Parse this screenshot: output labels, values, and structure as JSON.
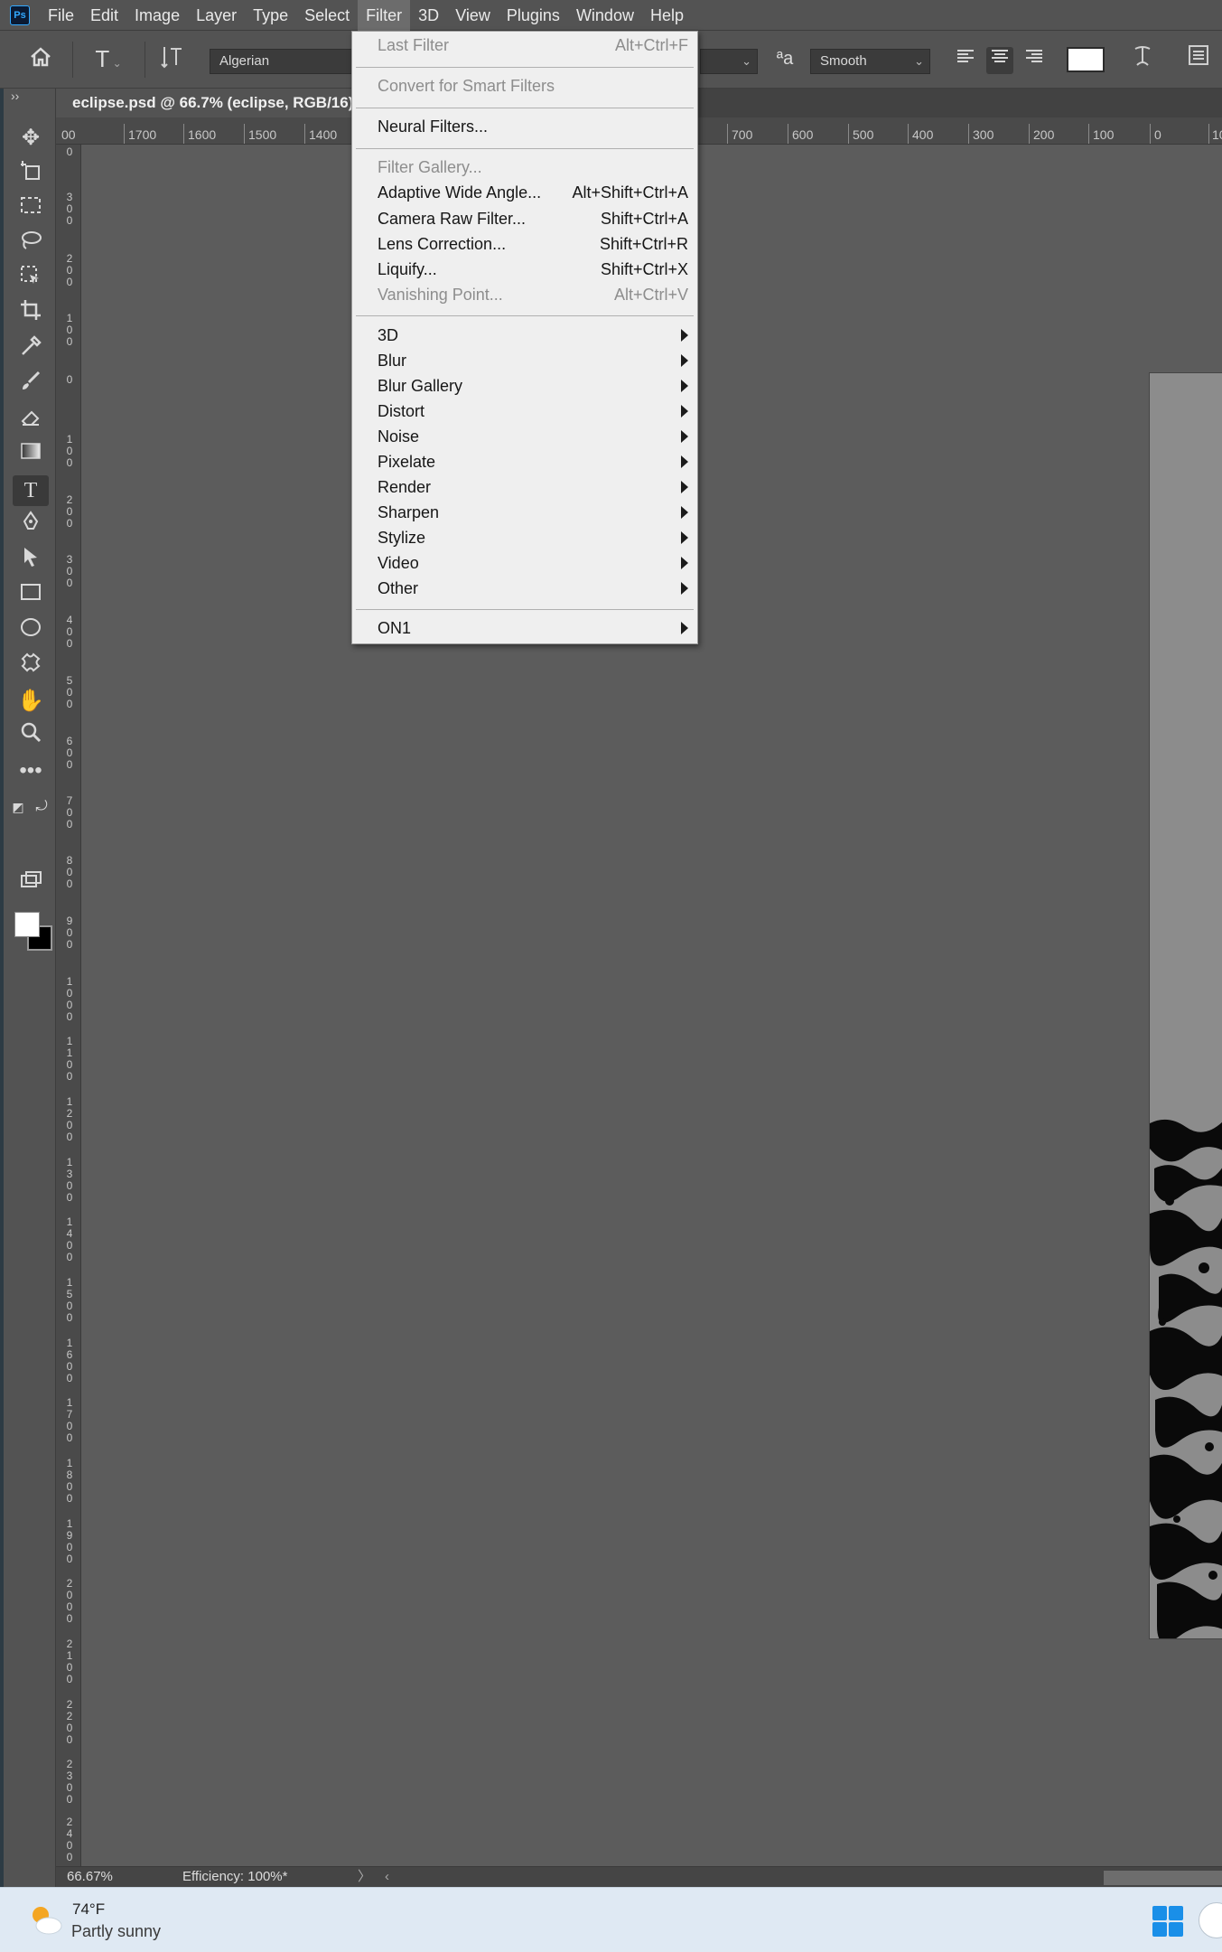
{
  "app": {
    "logo_text": "Ps",
    "menus": [
      "File",
      "Edit",
      "Image",
      "Layer",
      "Type",
      "Select",
      "Filter",
      "3D",
      "View",
      "Plugins",
      "Window",
      "Help"
    ],
    "active_menu": "Filter"
  },
  "options": {
    "font_family": "Algerian",
    "font_style_placeholder": "",
    "anti_alias_glyph": "aa",
    "anti_alias": "Smooth",
    "color": "#ffffff"
  },
  "document": {
    "tab_title": "eclipse.psd @ 66.7% (eclipse, RGB/16) *"
  },
  "ruler": {
    "h_labels": [
      "00",
      "1700",
      "1600",
      "1500",
      "1400",
      "700",
      "600",
      "500",
      "400",
      "300",
      "200",
      "100",
      "0",
      "10"
    ],
    "v_labels": [
      "0",
      "300",
      "200",
      "100",
      "0",
      "100",
      "200",
      "300",
      "400",
      "500",
      "600",
      "700",
      "800",
      "900",
      "1000",
      "1100",
      "1200",
      "1300",
      "1400",
      "1500",
      "1600",
      "1700",
      "1800",
      "1900",
      "2000",
      "2100",
      "2200",
      "2300",
      "2400"
    ]
  },
  "filter_menu": {
    "items": [
      {
        "label": "Last Filter",
        "shortcut": "Alt+Ctrl+F",
        "disabled": true
      },
      {
        "label": "Convert for Smart Filters",
        "shortcut": "",
        "disabled": true
      },
      {
        "label": "Neural Filters...",
        "shortcut": "",
        "disabled": false
      },
      {
        "label": "Filter Gallery...",
        "shortcut": "",
        "disabled": true
      },
      {
        "label": "Adaptive Wide Angle...",
        "shortcut": "Alt+Shift+Ctrl+A",
        "disabled": false
      },
      {
        "label": "Camera Raw Filter...",
        "shortcut": "Shift+Ctrl+A",
        "disabled": false
      },
      {
        "label": "Lens Correction...",
        "shortcut": "Shift+Ctrl+R",
        "disabled": false
      },
      {
        "label": "Liquify...",
        "shortcut": "Shift+Ctrl+X",
        "disabled": false
      },
      {
        "label": "Vanishing Point...",
        "shortcut": "Alt+Ctrl+V",
        "disabled": true
      },
      {
        "label": "3D",
        "submenu": true
      },
      {
        "label": "Blur",
        "submenu": true
      },
      {
        "label": "Blur Gallery",
        "submenu": true
      },
      {
        "label": "Distort",
        "submenu": true
      },
      {
        "label": "Noise",
        "submenu": true
      },
      {
        "label": "Pixelate",
        "submenu": true
      },
      {
        "label": "Render",
        "submenu": true
      },
      {
        "label": "Sharpen",
        "submenu": true
      },
      {
        "label": "Stylize",
        "submenu": true
      },
      {
        "label": "Video",
        "submenu": true
      },
      {
        "label": "Other",
        "submenu": true
      },
      {
        "label": "ON1",
        "submenu": true
      }
    ]
  },
  "status": {
    "zoom": "66.67%",
    "efficiency": "Efficiency: 100%*"
  },
  "taskbar": {
    "temperature": "74°F",
    "condition": "Partly sunny"
  },
  "colors": {
    "foreground": "#ffffff",
    "background": "#000000",
    "accent": "#31a8ff"
  },
  "icons": {
    "tools": [
      "move-icon",
      "artboard-icon",
      "marquee-icon",
      "lasso-icon",
      "object-select-icon",
      "crop-icon",
      "eyedropper-icon",
      "brush-icon",
      "eraser-icon",
      "gradient-icon",
      "type-icon",
      "pen-icon",
      "path-select-icon",
      "rectangle-icon",
      "ellipse-icon",
      "custom-shape-icon",
      "hand-icon",
      "zoom-icon",
      "more-tools-icon"
    ]
  }
}
